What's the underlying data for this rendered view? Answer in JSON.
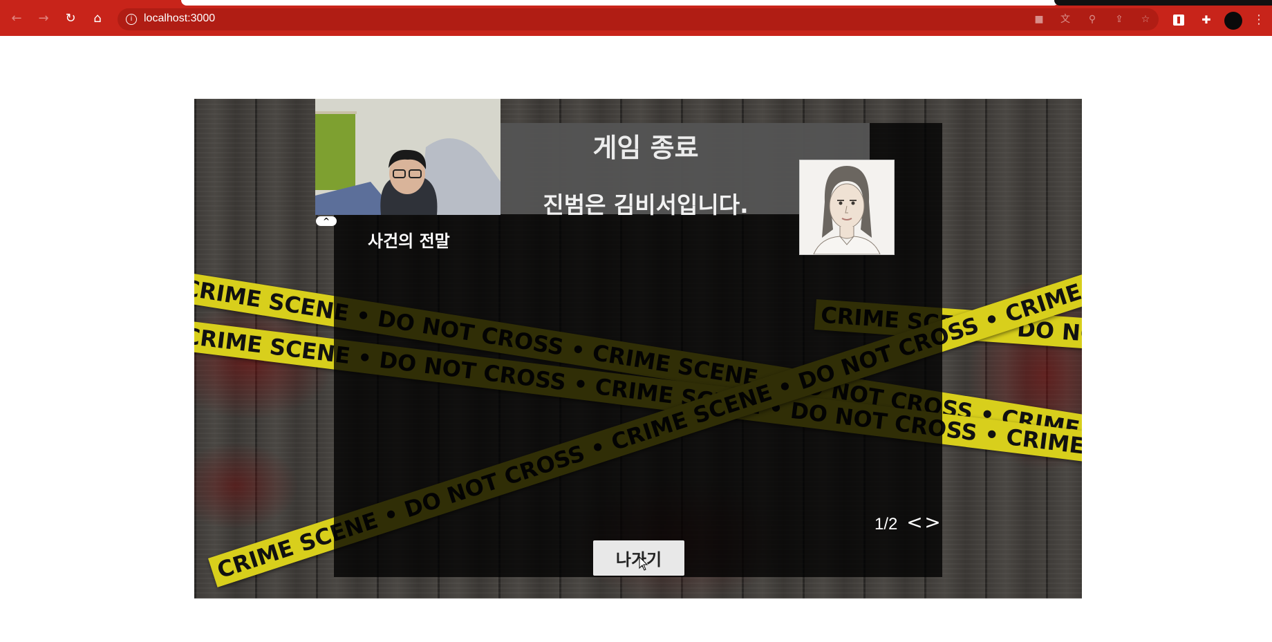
{
  "browser": {
    "url": "localhost:3000",
    "icons": {
      "back": "back-arrow-icon",
      "forward": "forward-arrow-icon",
      "reload": "reload-icon",
      "home": "home-icon",
      "site_info": "info-icon",
      "camera": "camera-icon",
      "translate": "translate-icon",
      "zoom": "zoom-icon",
      "share": "share-icon",
      "bookmark": "star-icon",
      "extensions": "puzzle-icon",
      "menu": "kebab-icon"
    },
    "accent": "#c8241a"
  },
  "game": {
    "title": "게임 종료",
    "culprit_message": "진범은 김비서입니다.",
    "story_heading": "사건의 전말",
    "webcam_toggle": "^",
    "pagination": {
      "current": 1,
      "total": 2,
      "label": "1/2",
      "prev": "<",
      "next": ">"
    },
    "exit_button": "나가기",
    "tape_text": "CRIME SCENE • DO NOT CROSS • CRIME SCENE • DO NOT CROSS • CRIME SCENE • DO NOT CROSS"
  }
}
